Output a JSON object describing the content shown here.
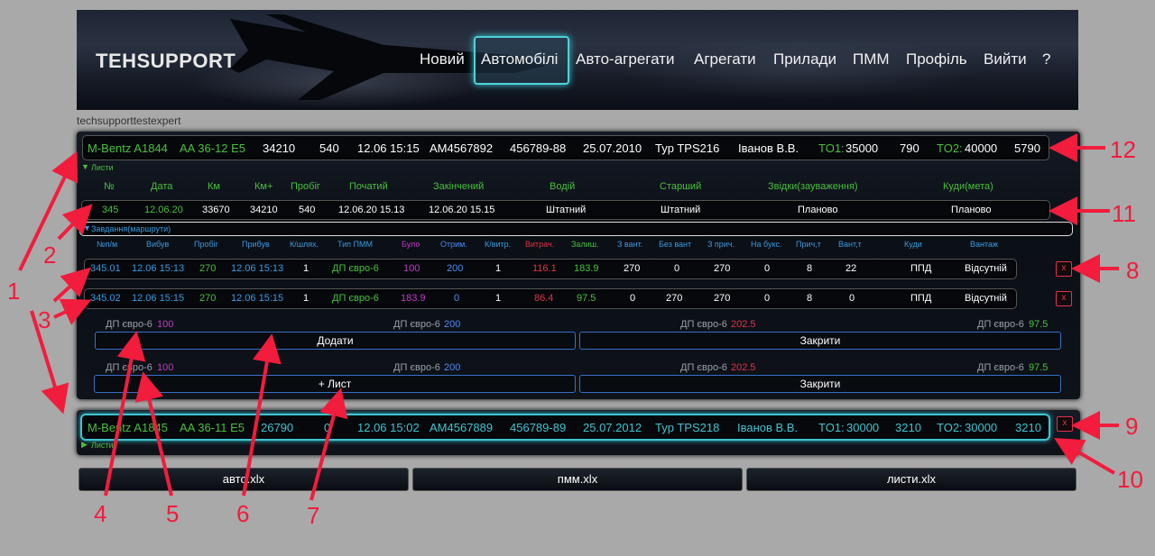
{
  "header": {
    "logo": "TEHSUPPORT",
    "nav": [
      "Новий",
      "Автомобілі",
      "Авто-агрегати",
      "Агрегати",
      "Прилади",
      "ПММ",
      "Профіль",
      "Вийти",
      "?"
    ],
    "active_nav": "Автомобілі"
  },
  "user": "techsupporttestexpert",
  "car1": {
    "model": "M-Bentz A1844",
    "plate": "AA 36-12 E5",
    "v1": "34210",
    "v2": "540",
    "datetime": "12.06 15:15",
    "am": "AM4567892",
    "code": "456789-88",
    "date": "25.07.2010",
    "type": "Typ TPS216",
    "person": "Іванов В.В.",
    "to1_label": "TO1:",
    "to1": "35000",
    "v3": "790",
    "to2_label": "TO2:",
    "to2": "40000",
    "v4": "5790"
  },
  "lists_label": "Листи",
  "list_headers": [
    "№",
    "Дата",
    "Км",
    "Км+",
    "Пробіг",
    "Початий",
    "Закінчений",
    "Водій",
    "Старший",
    "Звідки(зауваження)",
    "Куди(мета)"
  ],
  "list_row": [
    "345",
    "12.06.20",
    "33670",
    "34210",
    "540",
    "12.06.20 15.13",
    "12.06.20 15.15",
    "Штатний",
    "Штатний",
    "Планово",
    "Планово"
  ],
  "tasks_label": "Завдання(маршрути)",
  "task_headers": [
    "№п/м",
    "Вибув",
    "Пробіг",
    "Прибув",
    "К/шлях.",
    "Тип ПММ",
    "Було",
    "Отрим.",
    "К/витр.",
    "Витрач.",
    "Залиш.",
    "З вант.",
    "Без вант",
    "З прич.",
    "На букс.",
    "Прич,т",
    "Вант,т",
    "Куди",
    "Вантаж"
  ],
  "task_rows": [
    [
      "345.01",
      "12.06 15:13",
      "270",
      "12.06 15:13",
      "1",
      "ДП євро-6",
      "100",
      "200",
      "1",
      "116.1",
      "183.9",
      "270",
      "0",
      "270",
      "0",
      "8",
      "22",
      "ППД",
      "Відсутній"
    ],
    [
      "345.02",
      "12.06 15:15",
      "270",
      "12.06 15:15",
      "1",
      "ДП євро-6",
      "183.9",
      "0",
      "1",
      "86.4",
      "97.5",
      "0",
      "270",
      "270",
      "0",
      "8",
      "0",
      "ППД",
      "Відсутній"
    ]
  ],
  "delete_label": "x",
  "summary1": {
    "fuel_label": "ДП євро-6",
    "a": "100",
    "b": "200",
    "c": "202.5",
    "d": "97.5"
  },
  "buttons1": {
    "add": "Додати",
    "close": "Закрити"
  },
  "summary2": {
    "fuel_label": "ДП євро-6",
    "a": "100",
    "b": "200",
    "c": "202.5",
    "d": "97.5"
  },
  "buttons2": {
    "add": "+ Лист",
    "close": "Закрити"
  },
  "car2": {
    "model": "M-Bentz A1845",
    "plate": "AA 36-11 E5",
    "v1": "26790",
    "v2": "0",
    "datetime": "12.06 15:02",
    "am": "AM4567889",
    "code": "456789-89",
    "date": "25.07.2012",
    "type": "Typ TPS218",
    "person": "Іванов В.В.",
    "to1_label": "TO1:",
    "to1": "30000",
    "v3": "3210",
    "to2_label": "TO2:",
    "to2": "30000",
    "v4": "3210"
  },
  "downloads": [
    "авто.xlx",
    "пмм.xlx",
    "листи.xlx"
  ],
  "annotations": [
    "1",
    "2",
    "3",
    "4",
    "5",
    "6",
    "7",
    "8",
    "9",
    "10",
    "11",
    "12"
  ],
  "colors": {
    "accent": "#3fc4cf",
    "green": "#48c03c",
    "blue": "#4a8cf5",
    "purple": "#c03cc6",
    "red": "#e0344a",
    "annotation": "#f21c3c"
  }
}
